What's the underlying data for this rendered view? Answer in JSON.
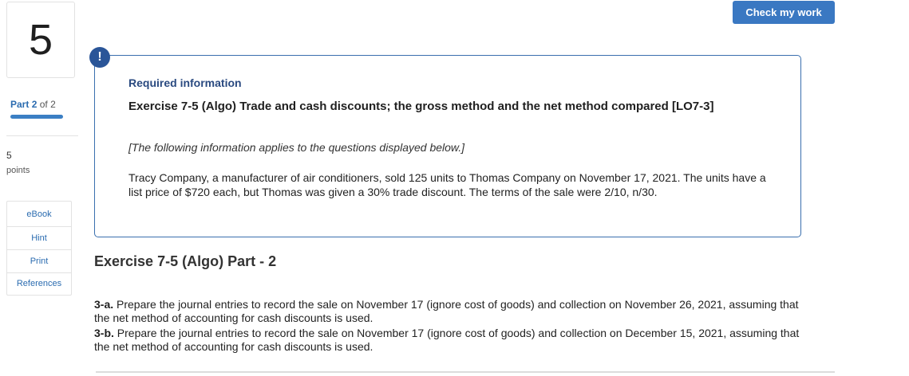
{
  "question": {
    "number": "5"
  },
  "part": {
    "prefix": "Part",
    "current": "2",
    "separator": "of",
    "total": "2",
    "progress_fraction": 1.0
  },
  "points": {
    "value": "5",
    "label": "points"
  },
  "tools": [
    "eBook",
    "Hint",
    "Print",
    "References"
  ],
  "header": {
    "check_button": "Check my work"
  },
  "info": {
    "icon_glyph": "!",
    "title": "Required information",
    "exercise_title": "Exercise 7-5 (Algo) Trade and cash discounts; the gross method and the net method compared [LO7-3]",
    "applies_note": "[The following information applies to the questions displayed below.]",
    "scenario": "Tracy Company, a manufacturer of air conditioners, sold 125 units to Thomas Company on November 17, 2021. The units have a list price of $720 each, but Thomas was given a 30% trade discount. The terms of the sale were 2/10, n/30."
  },
  "part_heading": "Exercise 7-5 (Algo) Part - 2",
  "instructions": [
    {
      "label": "3-a.",
      "text": " Prepare the journal entries to record the sale on November 17 (ignore cost of goods) and collection on November 26, 2021, assuming that the net method of accounting for cash discounts is used."
    },
    {
      "label": "3-b.",
      "text": " Prepare the journal entries to record the sale on November 17 (ignore cost of goods) and collection on December 15, 2021, assuming that the net method of accounting for cash discounts is used."
    }
  ],
  "colors": {
    "accent": "#3a78c2",
    "info_border": "#3a6fae",
    "icon_bg": "#2a5598",
    "link": "#2b6cb0"
  }
}
